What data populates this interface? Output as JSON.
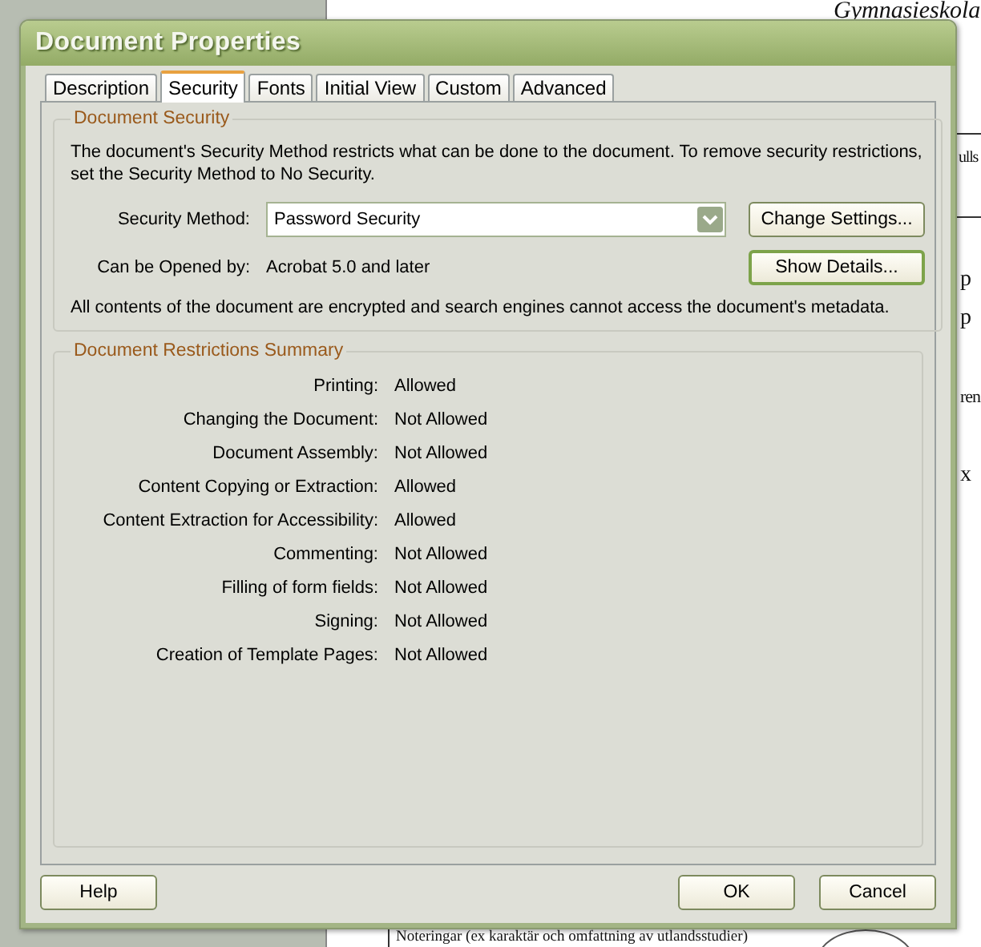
{
  "background_document": {
    "texts": [
      "Gymnasieskola",
      "ulls",
      "p",
      "p",
      "ren",
      "x",
      "Noteringar (ex karaktär och omfattning av utlandsstudier)"
    ]
  },
  "window": {
    "title": "Document Properties"
  },
  "tabs": [
    {
      "label": "Description",
      "selected": false
    },
    {
      "label": "Security",
      "selected": true
    },
    {
      "label": "Fonts",
      "selected": false
    },
    {
      "label": "Initial View",
      "selected": false
    },
    {
      "label": "Custom",
      "selected": false
    },
    {
      "label": "Advanced",
      "selected": false
    }
  ],
  "document_security": {
    "heading": "Document Security",
    "description": "The document's Security Method restricts what can be done to the document. To remove security restrictions, set the Security Method to No Security.",
    "security_method": {
      "label": "Security Method:",
      "value": "Password Security"
    },
    "change_settings_button": "Change Settings...",
    "opened_by": {
      "label": "Can be Opened by:",
      "value": "Acrobat 5.0 and later"
    },
    "show_details_button": "Show Details...",
    "note": "All contents of the document are encrypted and search engines cannot access the document's metadata."
  },
  "restrictions": {
    "heading": "Document Restrictions Summary",
    "rows": [
      {
        "label": "Printing:",
        "value": "Allowed"
      },
      {
        "label": "Changing the Document:",
        "value": "Not Allowed"
      },
      {
        "label": "Document Assembly:",
        "value": "Not Allowed"
      },
      {
        "label": "Content Copying or Extraction:",
        "value": "Allowed"
      },
      {
        "label": "Content Extraction for Accessibility:",
        "value": "Allowed"
      },
      {
        "label": "Commenting:",
        "value": "Not Allowed"
      },
      {
        "label": "Filling of form fields:",
        "value": "Not Allowed"
      },
      {
        "label": "Signing:",
        "value": "Not Allowed"
      },
      {
        "label": "Creation of Template Pages:",
        "value": "Not Allowed"
      }
    ]
  },
  "buttons": {
    "help": "Help",
    "ok": "OK",
    "cancel": "Cancel"
  }
}
